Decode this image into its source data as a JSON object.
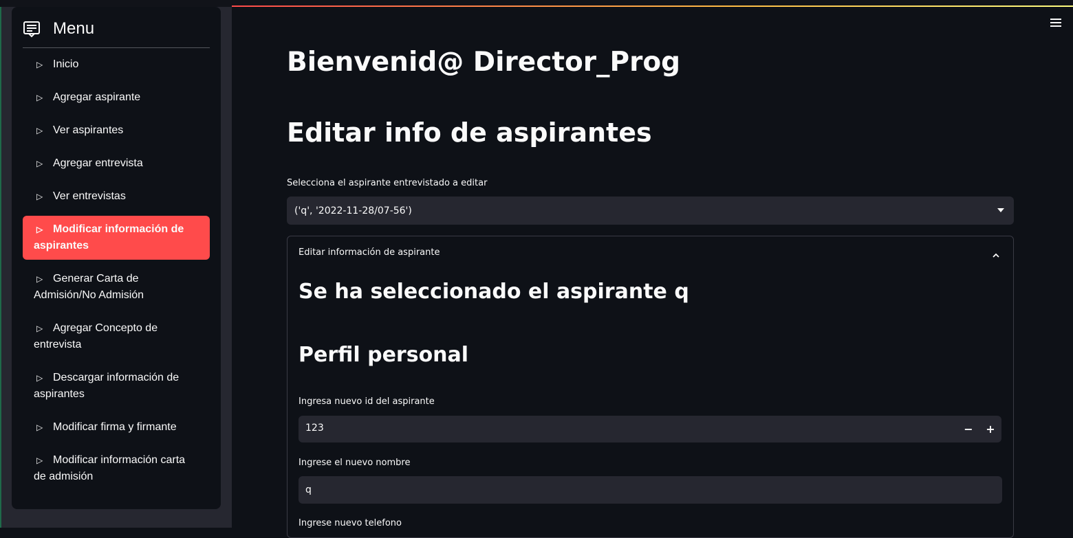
{
  "sidebar": {
    "title": "Menu",
    "items": [
      {
        "label": "Inicio"
      },
      {
        "label": "Agregar aspirante"
      },
      {
        "label": "Ver aspirantes"
      },
      {
        "label": "Agregar entrevista"
      },
      {
        "label": "Ver entrevistas"
      },
      {
        "label": "Modificar información de aspirantes",
        "active": true
      },
      {
        "label": "Generar Carta de Admisión/No Admisión"
      },
      {
        "label": "Agregar Concepto de entrevista"
      },
      {
        "label": "Descargar información de aspirantes"
      },
      {
        "label": "Modificar firma y firmante"
      },
      {
        "label": "Modificar información carta de admisión"
      }
    ]
  },
  "main": {
    "welcome": "Bienvenid@ Director_Prog",
    "section_title": "Editar info de aspirantes",
    "select_label": "Selecciona el aspirante entrevistado a editar",
    "select_value": "('q', '2022-11-28/07-56')",
    "expander": {
      "title": "Editar información de aspirante",
      "selected_heading": "Se ha seleccionado el aspirante q",
      "profile_heading": "Perfil personal",
      "id_label": "Ingresa nuevo id del aspirante",
      "id_value": "123",
      "name_label": "Ingrese el nuevo nombre",
      "name_value": "q",
      "phone_label": "Ingrese nuevo telefono"
    }
  },
  "colors": {
    "accent": "#ff4b4b",
    "background": "#0e1117",
    "sidebar": "#262730",
    "input": "#262730"
  }
}
